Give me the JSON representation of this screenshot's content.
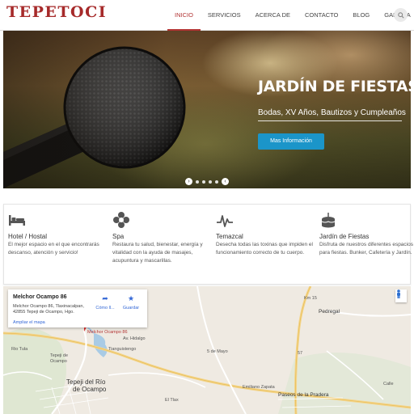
{
  "brand": {
    "logo_text": "TEPETOCI",
    "accent": "#a62a2a"
  },
  "nav": {
    "items": [
      {
        "label": "INICIO",
        "active": true
      },
      {
        "label": "SERVICIOS"
      },
      {
        "label": "ACERCA DE"
      },
      {
        "label": "CONTACTO"
      },
      {
        "label": "BLOG"
      },
      {
        "label": "GALERÍA"
      }
    ],
    "search_icon": "search-icon"
  },
  "hero": {
    "title": "JARDÍN DE FIESTAS",
    "subtitle": "Bodas, XV Años, Bautizos y Cumpleaños",
    "button_label": "Mas Información",
    "button_color": "#1b95c9",
    "slide_count": 5
  },
  "services": [
    {
      "icon": "bed-icon",
      "title": "Hotel / Hostal",
      "text": "El mejor espacio en el que encontrarás descanso, atención y servicio!"
    },
    {
      "icon": "flower-icon",
      "title": "Spa",
      "text": "Restaura tu salud, bienestar, energía y vitalidad con la ayuda de masajes, acupuntura y mascarillas."
    },
    {
      "icon": "heartbeat-icon",
      "title": "Temazcal",
      "text": "Desecha todas las toxinas que impiden el funcionamiento correcto de tu cuerpo."
    },
    {
      "icon": "cake-icon",
      "title": "Jardín de Fiestas",
      "text": "Disfruta de nuestros diferentes espacios para fiestas. Bunker, Cafetería y Jardín."
    }
  ],
  "map": {
    "card": {
      "title": "Melchor Ocampo 86",
      "address": "Melchor Ocampo 86, Tlaxinacalpan, 42855 Tepeji de Ocampo, Hgo.",
      "enlarge_link": "Ampliar el mapa",
      "directions_label": "Cómo ll...",
      "save_label": "Guardar"
    },
    "labels": {
      "pin": "Melchor Ocampo 86",
      "pedregal": "Pedregal",
      "tepeji_small": "Tepeji de Ocampo",
      "tianguistengo": "Tianguistengo",
      "tepeji_big_1": "Tepeji del Río",
      "tepeji_big_2": "de Ocampo",
      "paseos": "Paseos de la Pradera",
      "road_1": "Km 15",
      "road_2": "57",
      "road_3": "5 de Mayo",
      "road_4": "Emiliano Zapata",
      "road_5": "Av. Hidalgo",
      "road_6": "Rio Tula",
      "road_7": "Calle",
      "road_8": "El Tlax"
    }
  }
}
